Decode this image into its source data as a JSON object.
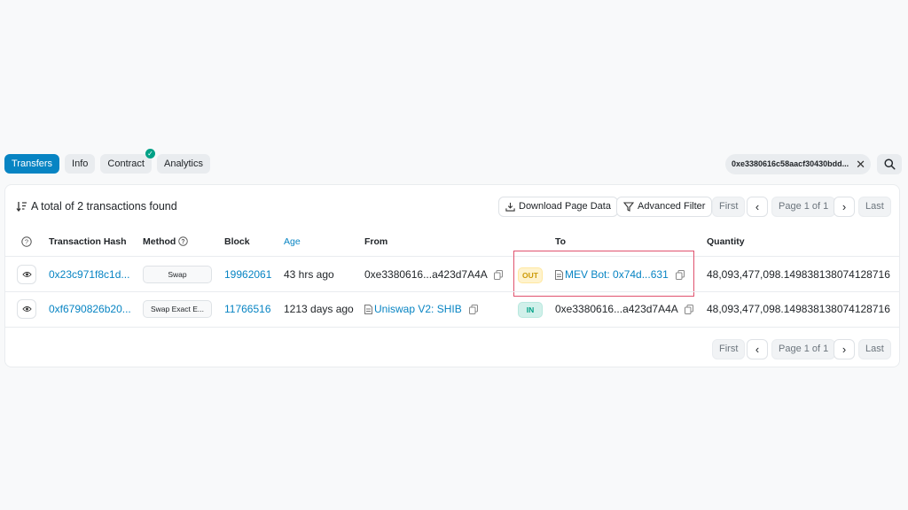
{
  "tabs": [
    {
      "label": "Transfers",
      "active": true
    },
    {
      "label": "Info"
    },
    {
      "label": "Contract",
      "verified": true
    },
    {
      "label": "Analytics"
    }
  ],
  "filter": {
    "address": "0xe3380616c58aacf30430bdd..."
  },
  "summary": {
    "text": "A total of 2 transactions found"
  },
  "toolbar": {
    "download": "Download Page Data",
    "advanced_filter": "Advanced Filter"
  },
  "pagination": {
    "first": "First",
    "page": "Page 1 of 1",
    "last": "Last"
  },
  "columns": {
    "hash": "Transaction Hash",
    "method": "Method",
    "block": "Block",
    "age": "Age",
    "from": "From",
    "to": "To",
    "quantity": "Quantity"
  },
  "rows": [
    {
      "hash": "0x23c971f8c1d...",
      "method": "Swap",
      "block": "19962061",
      "age": "43 hrs ago",
      "from": "0xe3380616...a423d7A4A",
      "direction": "OUT",
      "to": "MEV Bot: 0x74d...631",
      "quantity": "48,093,477,098.149838138074128716"
    },
    {
      "hash": "0xf6790826b20...",
      "method": "Swap Exact E...",
      "block": "11766516",
      "age": "1213 days ago",
      "from": "Uniswap V2: SHIB",
      "direction": "IN",
      "to": "0xe3380616...a423d7A4A",
      "quantity": "48,093,477,098.149838138074128716"
    }
  ],
  "colors": {
    "accent": "#0784c3",
    "out": "#cc9a06",
    "in": "#00a186",
    "highlight": "#e0526e"
  }
}
